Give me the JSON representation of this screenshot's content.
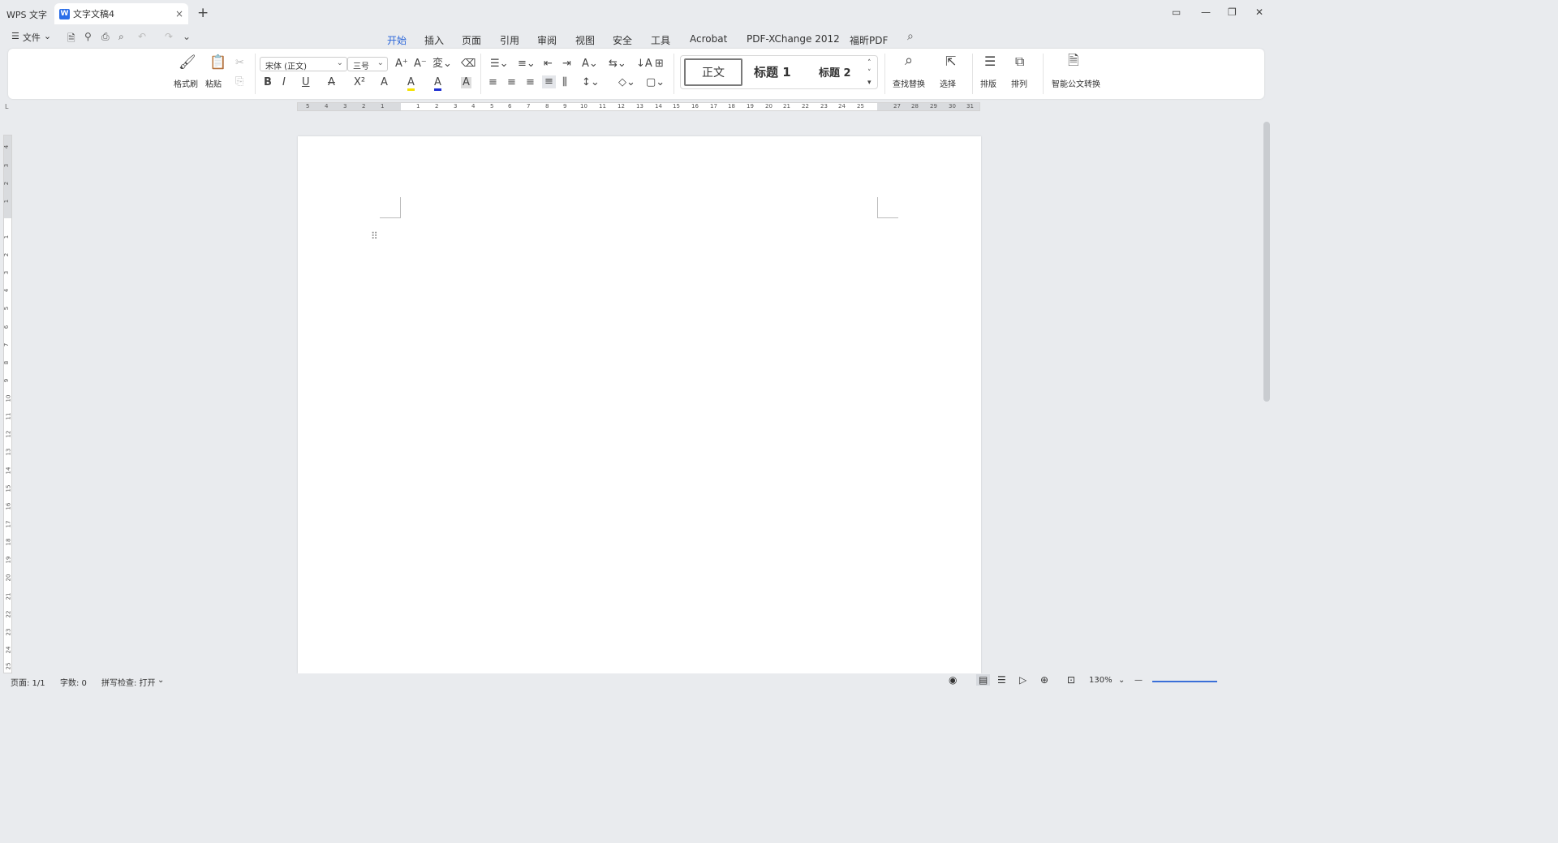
{
  "titlebar": {
    "app_tab": "WPS 文字",
    "doc_tab": "文字文稿4",
    "doc_icon": "W",
    "close": "×",
    "new_tab": "+"
  },
  "menubar": {
    "file": "文件",
    "tabs": [
      "开始",
      "插入",
      "页面",
      "引用",
      "审阅",
      "视图",
      "安全",
      "工具",
      "Acrobat",
      "PDF-XChange 2012",
      "福昕PDF"
    ],
    "active_tab": "开始"
  },
  "ribbon": {
    "format_painter": "格式刷",
    "paste": "粘贴",
    "font_name": "宋体 (正文)",
    "font_size": "三号",
    "bold": "B",
    "italic": "I",
    "underline": "U",
    "strike": "A",
    "superscript": "X²",
    "texteffect": "A",
    "highlight": "A",
    "fontcolor": "A",
    "charshade": "A",
    "styles": {
      "normal": "正文",
      "h1": "标题 1",
      "h2": "标题 2"
    },
    "find_replace": "查找替换",
    "select": "选择",
    "layout": "排版",
    "arrange": "排列",
    "smart_convert": "智能公文转换"
  },
  "ruler": {
    "h_left": [
      "5",
      "4",
      "3",
      "2",
      "1"
    ],
    "h_right": [
      "1",
      "2",
      "3",
      "4",
      "5",
      "6",
      "7",
      "8",
      "9",
      "10",
      "11",
      "12",
      "13",
      "14",
      "15",
      "16",
      "17",
      "18",
      "19",
      "20",
      "21",
      "22",
      "23",
      "24",
      "25",
      "27",
      "28",
      "29",
      "30",
      "31"
    ],
    "v_top": [
      "4",
      "3",
      "2",
      "1"
    ],
    "v_bottom": [
      "1",
      "2",
      "3",
      "4",
      "5",
      "6",
      "7",
      "8",
      "9",
      "10",
      "11",
      "12",
      "13",
      "14",
      "15",
      "16",
      "17",
      "18",
      "19",
      "20",
      "21",
      "22",
      "23",
      "24",
      "25"
    ],
    "corner": "L"
  },
  "status": {
    "page": "页面: 1/1",
    "words": "字数: 0",
    "spell": "拼写检查: 打开",
    "zoom": "130%"
  }
}
